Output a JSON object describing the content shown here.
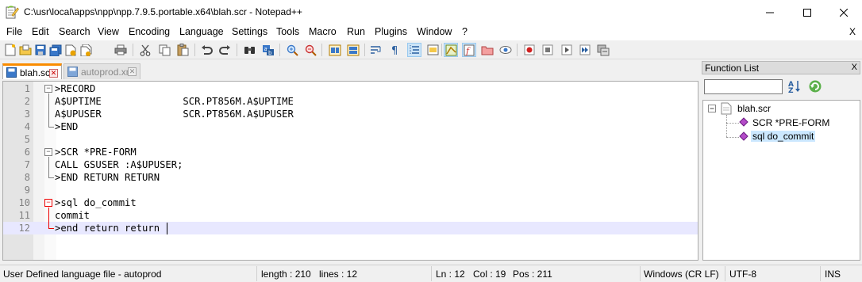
{
  "window": {
    "title": "C:\\usr\\local\\apps\\npp\\npp.7.9.5.portable.x64\\blah.scr - Notepad++"
  },
  "menu": {
    "items": [
      {
        "label": "File"
      },
      {
        "label": "Edit"
      },
      {
        "label": "Search"
      },
      {
        "label": "View"
      },
      {
        "label": "Encoding"
      },
      {
        "label": "Language"
      },
      {
        "label": "Settings"
      },
      {
        "label": "Tools"
      },
      {
        "label": "Macro"
      },
      {
        "label": "Run"
      },
      {
        "label": "Plugins"
      },
      {
        "label": "Window"
      },
      {
        "label": "?"
      }
    ],
    "close_label": "X"
  },
  "toolbar": {
    "icons": [
      "new-file-icon",
      "open-file-icon",
      "save-icon",
      "save-all-icon",
      "close-icon",
      "close-all-icon",
      "print-icon",
      "cut-icon",
      "copy-icon",
      "paste-icon",
      "undo-icon",
      "redo-icon",
      "find-icon",
      "replace-icon",
      "zoom-in-icon",
      "zoom-out-icon",
      "sync-vertical-icon",
      "sync-horizontal-icon",
      "word-wrap-icon",
      "show-all-chars-icon",
      "indent-guide-icon",
      "user-language-icon",
      "doc-map-icon",
      "function-list-icon",
      "folder-workspace-icon",
      "monitoring-icon",
      "record-macro-icon",
      "stop-record-icon",
      "playback-icon",
      "run-macro-multiple-icon",
      "save-macro-icon"
    ]
  },
  "tabs": [
    {
      "label": "blah.scr",
      "active": true
    },
    {
      "label": "autoprod.xml",
      "active": false
    }
  ],
  "editor": {
    "lines": [
      {
        "num": "1",
        "text": ">RECORD"
      },
      {
        "num": "2",
        "text": "A$UPTIME              SCR.PT856M.A$UPTIME"
      },
      {
        "num": "3",
        "text": "A$UPUSER              SCR.PT856M.A$UPUSER"
      },
      {
        "num": "4",
        "text": ">END"
      },
      {
        "num": "5",
        "text": ""
      },
      {
        "num": "6",
        "text": ">SCR *PRE-FORM"
      },
      {
        "num": "7",
        "text": "CALL GSUSER :A$UPUSER;"
      },
      {
        "num": "8",
        "text": ">END RETURN RETURN"
      },
      {
        "num": "9",
        "text": ""
      },
      {
        "num": "10",
        "text": ">sql do_commit"
      },
      {
        "num": "11",
        "text": "commit"
      },
      {
        "num": "12",
        "text": ">end return return"
      }
    ]
  },
  "function_list": {
    "title": "Function List",
    "close_label": "X",
    "search_value": "",
    "root": "blah.scr",
    "functions": [
      "SCR *PRE-FORM",
      "sql do_commit"
    ]
  },
  "status": {
    "language": "User Defined language file - autoprod",
    "length": "length : 210",
    "lines": "lines : 12",
    "ln": "Ln : 12",
    "col": "Col : 19",
    "pos": "Pos : 211",
    "eol": "Windows (CR LF)",
    "encoding": "UTF-8",
    "mode": "INS"
  }
}
